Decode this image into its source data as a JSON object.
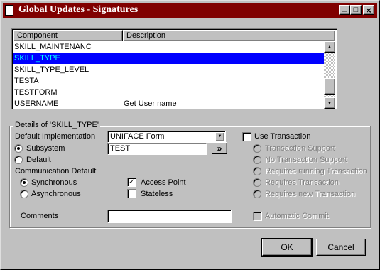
{
  "window": {
    "title": "Global Updates - Signatures",
    "minimize_glyph": "_",
    "maximize_glyph": "□",
    "close_glyph": "×"
  },
  "list": {
    "columns": [
      "Component",
      "Description"
    ],
    "rows": [
      {
        "component": "SKILL_MAINTENANC",
        "description": ""
      },
      {
        "component": "SKILL_TYPE",
        "description": "",
        "selected": true
      },
      {
        "component": "SKILL_TYPE_LEVEL",
        "description": ""
      },
      {
        "component": "TESTA",
        "description": ""
      },
      {
        "component": "TESTFORM",
        "description": ""
      },
      {
        "component": "USERNAME",
        "description": "Get User name"
      }
    ],
    "scroll_fraction": 0.9
  },
  "details": {
    "group_label": "Details of 'SKILL_TYPE'",
    "default_implementation_label": "Default Implementation",
    "default_implementation_value": "UNIFACE Form",
    "subsystem_label": "Subsystem",
    "subsystem_value": "TEST",
    "subsystem_button": "»",
    "default_label": "Default",
    "communication_default_label": "Communication Default",
    "synchronous_label": "Synchronous",
    "asynchronous_label": "Asynchronous",
    "access_point_label": "Access Point",
    "stateless_label": "Stateless",
    "comments_label": "Comments",
    "comments_value": "",
    "use_transaction_label": "Use Transaction",
    "transaction_options": [
      "Transaction Support",
      "No Transaction Support",
      "Requires running Transaction",
      "Requires Transaction",
      "Requires new Transaction"
    ],
    "automatic_commit_label": "Automatic Commit"
  },
  "buttons": {
    "ok": "OK",
    "cancel": "Cancel"
  },
  "colors": {
    "titlebar": "#800000",
    "selection_bg": "#0000ff",
    "selection_fg": "#00ffff",
    "face": "#c0c0c0"
  }
}
